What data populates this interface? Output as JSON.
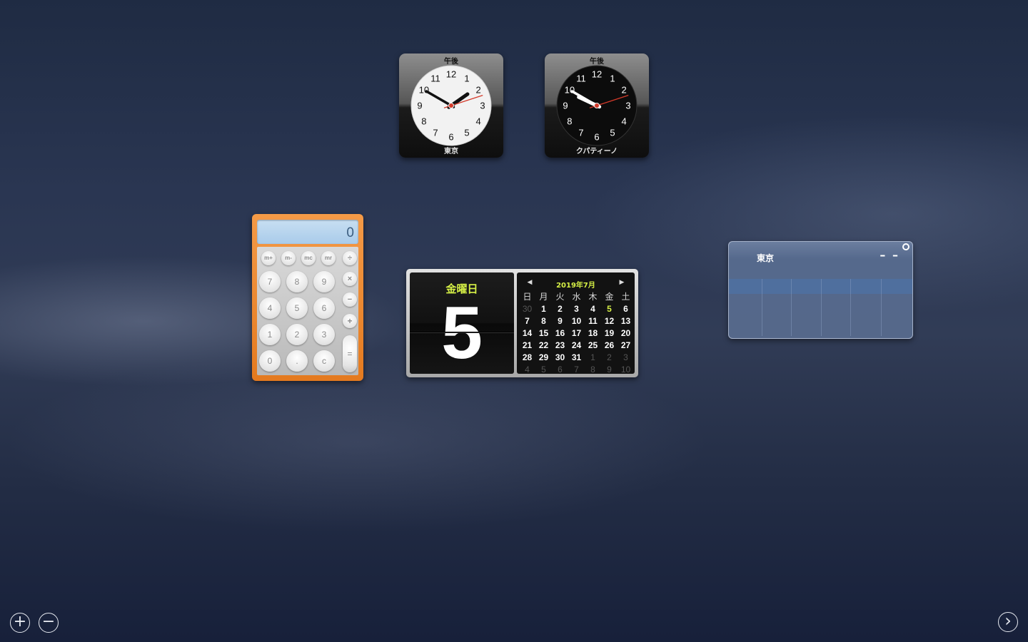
{
  "clocks": [
    {
      "ampm": "午後",
      "city": "東京",
      "hour": 1,
      "minute": 50,
      "second": 12
    },
    {
      "ampm": "午後",
      "city": "クパティーノ",
      "hour": 9,
      "minute": 50,
      "second": 12
    }
  ],
  "calculator": {
    "display": "0",
    "memory_keys": [
      "m+",
      "m-",
      "mc",
      "mr"
    ],
    "divide": "÷",
    "multiply": "×",
    "minus": "−",
    "plus": "+",
    "equals": "=",
    "digits": [
      "7",
      "8",
      "9",
      "4",
      "5",
      "6",
      "1",
      "2",
      "3",
      "0",
      "."
    ],
    "clear": "c"
  },
  "calendar": {
    "weekday": "金曜日",
    "day": "5",
    "month_label": "2019年7月",
    "dow": [
      "日",
      "月",
      "火",
      "水",
      "木",
      "金",
      "土"
    ],
    "weeks": [
      [
        "30",
        "1",
        "2",
        "3",
        "4",
        "5",
        "6"
      ],
      [
        "7",
        "8",
        "9",
        "10",
        "11",
        "12",
        "13"
      ],
      [
        "14",
        "15",
        "16",
        "17",
        "18",
        "19",
        "20"
      ],
      [
        "21",
        "22",
        "23",
        "24",
        "25",
        "26",
        "27"
      ],
      [
        "28",
        "29",
        "30",
        "31",
        "1",
        "2",
        "3"
      ],
      [
        "4",
        "5",
        "6",
        "7",
        "8",
        "9",
        "10"
      ]
    ],
    "today": "5"
  },
  "weather": {
    "city": "東京",
    "temperature": "– –"
  },
  "controls": {
    "add": "+",
    "remove": "−",
    "next": "›"
  }
}
